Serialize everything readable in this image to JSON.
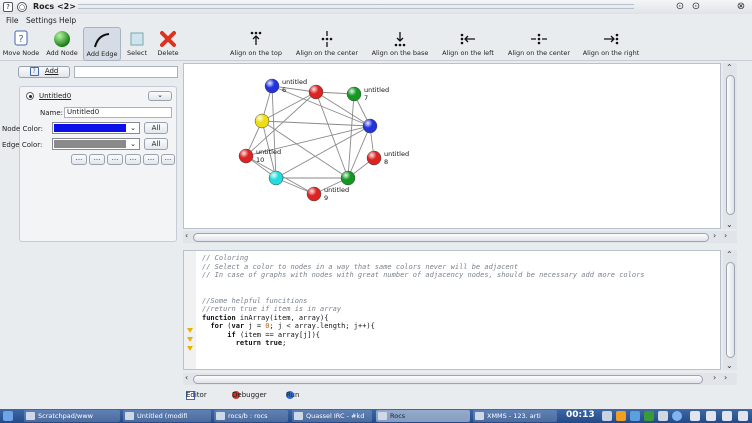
{
  "window": {
    "title": "Rocs <2>",
    "help_glyph": "?",
    "menu_glyph": "○",
    "minimize_glyph": "⊙",
    "maximize_glyph": "⊙",
    "close_glyph": "⊗"
  },
  "menu": [
    "File",
    "Settings",
    "Help"
  ],
  "toolbar": [
    {
      "label": "Move Node",
      "icon": "help-icon"
    },
    {
      "label": "Add Node",
      "icon": "green-sphere-icon"
    },
    {
      "label": "Add Edge",
      "icon": "curve-icon",
      "active": true
    },
    {
      "label": "Select",
      "icon": "select-box-icon"
    },
    {
      "label": "Delete",
      "icon": "red-x-icon"
    },
    {
      "label": "Align on the top",
      "icon": "align-top-icon"
    },
    {
      "label": "Align on the center",
      "icon": "align-vcenter-icon"
    },
    {
      "label": "Align on the base",
      "icon": "align-bottom-icon"
    },
    {
      "label": "Align on the left",
      "icon": "align-left-icon"
    },
    {
      "label": "Align on the center",
      "icon": "align-hcenter-icon"
    },
    {
      "label": "Align on the right",
      "icon": "align-right-icon"
    }
  ],
  "left_panel": {
    "add_button": "Add",
    "graph_title": "Untitled0",
    "name_label": "Name:",
    "name_value": "Untitled0",
    "collapse_label": "⌄",
    "node_color_label": "Node Color:",
    "node_color": "#0b10e8",
    "edge_color_label": "Edge Color:",
    "edge_color": "#8a8a8a",
    "all_label": "All",
    "small_buttons": [
      "...",
      "...",
      "...",
      "...",
      "...",
      "..."
    ]
  },
  "graph": {
    "nodes": [
      {
        "id": "n1",
        "color": "#2233dd",
        "label": [
          "untitled",
          "6"
        ]
      },
      {
        "id": "n2",
        "color": "#dd2222",
        "label": []
      },
      {
        "id": "n3",
        "color": "#119922",
        "label": [
          "untitled",
          "7"
        ]
      },
      {
        "id": "n4",
        "color": "#eedd11",
        "label": []
      },
      {
        "id": "n5",
        "color": "#2233dd",
        "label": []
      },
      {
        "id": "n6",
        "color": "#dd2222",
        "label": [
          "untitled",
          "10"
        ]
      },
      {
        "id": "n7",
        "color": "#dd2222",
        "label": [
          "untitled",
          "8"
        ]
      },
      {
        "id": "n8",
        "color": "#22dddd",
        "label": []
      },
      {
        "id": "n9",
        "color": "#119922",
        "label": []
      },
      {
        "id": "n10",
        "color": "#dd2222",
        "label": [
          "untitled",
          "9"
        ]
      }
    ]
  },
  "editor": {
    "lines": [
      {
        "t": "// Coloring",
        "c": "c"
      },
      {
        "t": "// Select a color to nodes in a way that same colors never will be adjacent",
        "c": "c"
      },
      {
        "t": "// In case of graphs with nodes with great number of adjacency nodes, should be necessary add more colors",
        "c": "c"
      },
      {
        "t": "",
        "c": ""
      },
      {
        "t": "",
        "c": ""
      },
      {
        "t": "//Some helpful funcitions",
        "c": "c"
      },
      {
        "t": "//return true if item is in array",
        "c": "c"
      },
      {
        "t": "function inArray(item, array){",
        "c": "code"
      },
      {
        "t": "  for (var j = 0; j < array.length; j++){",
        "c": "code"
      },
      {
        "t": "      if (item == array[j]){",
        "c": "code"
      },
      {
        "t": "        return true;",
        "c": "code"
      }
    ]
  },
  "bottom_tabs": [
    {
      "label": "Editor",
      "icon": "editor-icon"
    },
    {
      "label": "Debugger",
      "icon": "bug-icon"
    },
    {
      "label": "Run",
      "icon": "run-icon"
    }
  ],
  "taskbar": {
    "items": [
      "Scratchpad/www",
      "Untitled (modifi",
      "rocs/b : rocs",
      "Quassel IRC - #kd",
      "Rocs",
      "XMMS - 123. arti"
    ],
    "clock": "00:13"
  }
}
